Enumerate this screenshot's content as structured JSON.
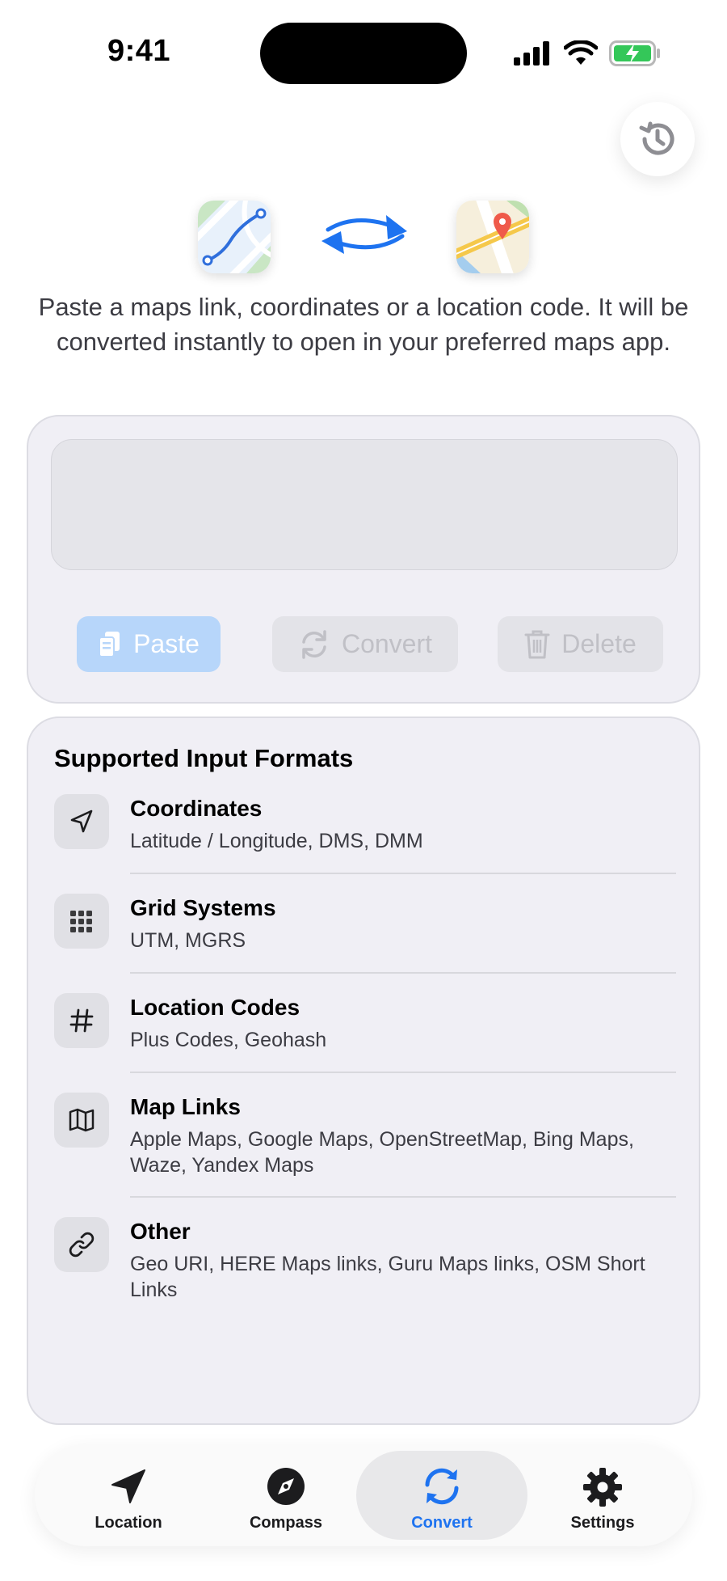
{
  "status_bar": {
    "time": "9:41"
  },
  "intro_text": "Paste a maps link, coordinates or a location code. It will be converted instantly to open in your preferred maps app.",
  "input": {
    "placeholder": ""
  },
  "actions": {
    "paste": "Paste",
    "convert": "Convert",
    "delete": "Delete"
  },
  "formats": {
    "title": "Supported Input Formats",
    "items": [
      {
        "icon": "location-arrow-icon",
        "title": "Coordinates",
        "subtitle": "Latitude / Longitude, DMS, DMM"
      },
      {
        "icon": "grid-icon",
        "title": "Grid Systems",
        "subtitle": "UTM, MGRS"
      },
      {
        "icon": "hashtag-icon",
        "title": "Location Codes",
        "subtitle": "Plus Codes, Geohash"
      },
      {
        "icon": "map-icon",
        "title": "Map Links",
        "subtitle": "Apple Maps, Google Maps, OpenStreetMap, Bing Maps, Waze, Yandex Maps"
      },
      {
        "icon": "link-icon",
        "title": "Other",
        "subtitle": "Geo URI, HERE Maps links, Guru Maps links, OSM Short Links"
      }
    ]
  },
  "tabs": [
    {
      "label": "Location",
      "icon": "location-arrow-icon"
    },
    {
      "label": "Compass",
      "icon": "compass-icon"
    },
    {
      "label": "Convert",
      "icon": "convert-icon",
      "active": true
    },
    {
      "label": "Settings",
      "icon": "gear-icon"
    }
  ],
  "colors": {
    "accent": "#1e73f0",
    "card_background": "#f0eff5",
    "battery": "#34c759"
  }
}
